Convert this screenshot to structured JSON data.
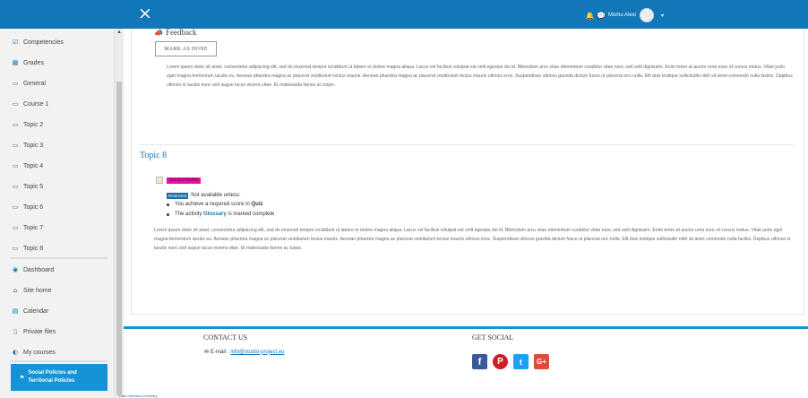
{
  "header": {
    "close_icon": "×",
    "user_name": "Momu Alexi",
    "caret": "▾"
  },
  "sidebar": {
    "items": [
      {
        "icon": "☑",
        "label": "Competencies"
      },
      {
        "icon": "▦",
        "label": "Grades"
      },
      {
        "icon": "▭",
        "label": "General"
      },
      {
        "icon": "▭",
        "label": "Course 1"
      },
      {
        "icon": "▭",
        "label": "Topic 2"
      },
      {
        "icon": "▭",
        "label": "Topic 3"
      },
      {
        "icon": "▭",
        "label": "Topic 4"
      },
      {
        "icon": "▭",
        "label": "Topic 5"
      },
      {
        "icon": "▭",
        "label": "Topic 6"
      },
      {
        "icon": "▭",
        "label": "Topic 7"
      },
      {
        "icon": "▭",
        "label": "Topic 8"
      }
    ],
    "items2": [
      {
        "icon": "◉",
        "label": "Dashboard"
      },
      {
        "icon": "⌂",
        "label": "Site home"
      },
      {
        "icon": "▤",
        "label": "Calendar"
      },
      {
        "icon": "▯",
        "label": "Private files"
      },
      {
        "icon": "◐",
        "label": "My courses"
      }
    ],
    "active": {
      "icon": "⚑",
      "label": "Social Policies and Territorial Policies"
    }
  },
  "content": {
    "feedback_title": "Feedback",
    "mark_done": "MARK AS DONE",
    "lorem1": "Lorem ipsum dolor sit amet, consectetur adipiscing elit, sed do eiusmod tempor incididunt ut labore et dolore magna aliqua. Lacus vel facilisis volutpat est velit egestas dui id. Bibendum arcu vitae elementum curabitur vitae nunc sed velit dignissim. Enim tortor at auctor urna nunc id cursus metus. Vitae justo eget magna fermentum iaculis eu. Aenean pharetra magna ac placerat vestibulum lectus mauris. Aenean pharetra magna ac placerat vestibulum lectus mauris ultrices eros. Suspendisse ultrices gravida dictum fusce ut placerat orci nulla. Elit duis tristique sollicitudin nibh sit amet commodo nulla facilisi. Dapibus ultrices in iaculis nunc sed augue lacus viverra vitae. Et malesuada fames ac turpis.",
    "topic8_title": "Topic 8",
    "activity_name": "Social Policies",
    "restricted_badge": "Restricted",
    "not_available": "Not available unless:",
    "cond1_prefix": "You achieve a required score in",
    "cond1_link": "Quiz",
    "cond2_prefix": "The activity",
    "cond2_link": "Glossary",
    "cond2_suffix": "is marked complete",
    "lorem2": "Lorem ipsum dolor sit amet, consectetur adipiscing elit, sed do eiusmod tempor incididunt ut labore et dolore magna aliqua. Lacus vel facilisis volutpat est velit egestas dui id. Bibendum arcu vitae elementum curabitur vitae nunc sed velit dignissim. Enim tortor at auctor urna nunc id cursus metus. Vitae justo eget magna fermentum iaculis eu. Aenean pharetra magna ac placerat vestibulum lectus mauris. Aenean pharetra magna ac placerat vestibulum lectus mauris ultrices eros. Suspendisse ultrices gravida dictum fusce ut placerat orci nulla. Elit duis tristique sollicitudin nibh sit amet commodo nulla facilisi. Dapibus ultrices in iaculis nunc sed augue lacus viverra vitae. Et malesuada fames ac turpis."
  },
  "footer": {
    "contact_heading": "CONTACT US",
    "email_label": "E-mail :",
    "email": "info@studio-project.eu",
    "social_heading": "GET SOCIAL",
    "retention": "Data retention summary"
  }
}
